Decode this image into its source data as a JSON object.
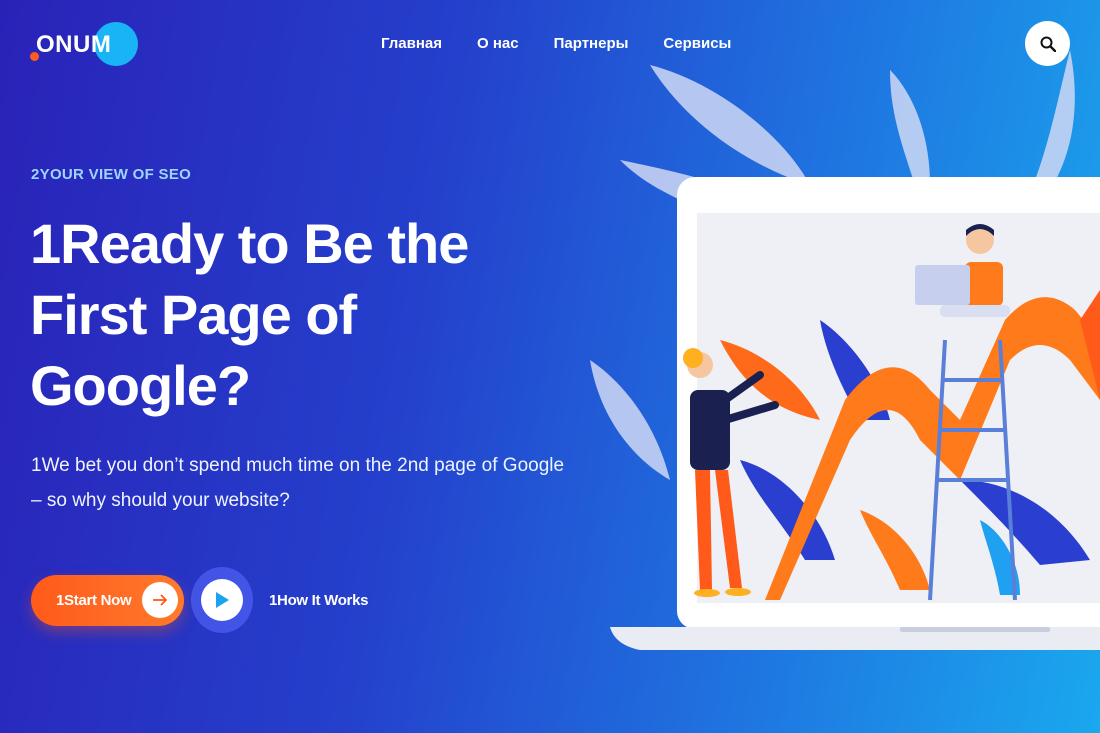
{
  "brand": {
    "name": "ONUM"
  },
  "nav": {
    "items": [
      "Главная",
      "О нас",
      "Партнеры",
      "Сервисы"
    ]
  },
  "hero": {
    "eyebrow": "2YOUR VIEW OF SEO",
    "headline_lines": [
      "1Ready to Be the",
      "First Page of",
      "Google?"
    ],
    "subtitle_lines": [
      "1We bet you don’t spend much time on the 2nd page of Google",
      "– so why should your website?"
    ],
    "cta_label": "1Start Now",
    "how_label": "1How It Works"
  },
  "icons": {
    "search": "search-icon",
    "arrow": "arrow-right-icon",
    "play": "play-icon"
  },
  "colors": {
    "accent_orange": "#ff5a1a",
    "accent_cyan": "#19b4f5",
    "play_blue": "#1aa3f0",
    "eyebrow": "#9fd4ff"
  }
}
